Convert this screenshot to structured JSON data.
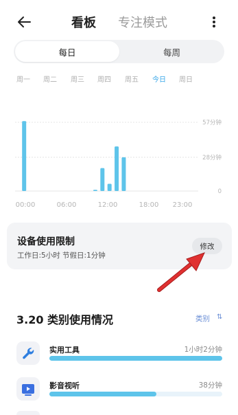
{
  "header": {
    "tabs": [
      "看板",
      "专注模式"
    ]
  },
  "segment": {
    "daily": "每日",
    "weekly": "每周"
  },
  "weekdays": [
    "周一",
    "周二",
    "周三",
    "周四",
    "周五",
    "今日",
    "周日"
  ],
  "chart_data": {
    "type": "bar",
    "y_ticks": [
      "57分钟",
      "28分钟",
      "0"
    ],
    "x_ticks": [
      "00:00",
      "06:00",
      "12:00",
      "18:00",
      "23:00"
    ],
    "ylim": [
      0,
      57
    ],
    "hours": [
      0,
      1,
      2,
      3,
      4,
      5,
      6,
      7,
      8,
      9,
      10,
      11,
      12,
      13,
      14,
      15,
      16,
      17,
      18,
      19,
      20,
      21,
      22,
      23
    ],
    "values": [
      58,
      0,
      0,
      0,
      0,
      0,
      0,
      0,
      0,
      0,
      1,
      19,
      6,
      37,
      28,
      0,
      0,
      0,
      0,
      0,
      0,
      0,
      0,
      0
    ],
    "bar_color": "#5ec4ea"
  },
  "limit": {
    "title": "设备使用限制",
    "subtitle": "工作日:5小时  节假日:1分钟",
    "edit": "修改"
  },
  "categories": {
    "title": "3.20 类别使用情况",
    "sort": "类别",
    "sort_icon": "⇅",
    "items": [
      {
        "name": "实用工具",
        "time": "1小时2分钟",
        "fraction": 1.0,
        "icon": "wrench-icon"
      },
      {
        "name": "影音视听",
        "time": "38分钟",
        "fraction": 0.62,
        "icon": "video-icon"
      }
    ]
  },
  "colors": {
    "accent": "#3aa7e8",
    "bar": "#5ec4ea",
    "arrow": "#e03131"
  }
}
